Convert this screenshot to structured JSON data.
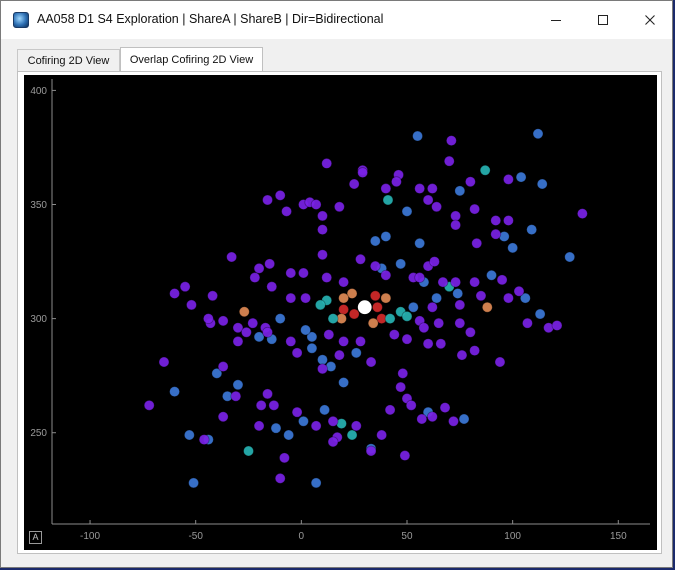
{
  "window": {
    "title": "AA058 D1 S4 Exploration | ShareA | ShareB | Dir=Bidirectional",
    "minimize_label": "—",
    "maximize_label": "☐",
    "close_label": "✕"
  },
  "tabs": [
    {
      "label": "Cofiring 2D View",
      "active": false
    },
    {
      "label": "Overlap Cofiring 2D View",
      "active": true
    }
  ],
  "plot": {
    "autoscale_label": "A",
    "background": "#000000"
  },
  "chart_data": {
    "type": "scatter",
    "title": "",
    "xlabel": "",
    "ylabel": "",
    "xlim": [
      -118,
      165
    ],
    "ylim": [
      210,
      405
    ],
    "xticks": [
      -100,
      -50,
      0,
      50,
      100,
      150
    ],
    "yticks": [
      250,
      300,
      350,
      400
    ],
    "grid": false,
    "legend": "none",
    "color_legend": {
      "purple": "#7a22e6",
      "blue": "#3c78d8",
      "teal": "#27b3b3",
      "orange": "#e08a55",
      "red": "#d42a2a",
      "highlight": "#ffffff"
    },
    "points": [
      {
        "x": 30,
        "y": 305,
        "c": "highlight"
      },
      {
        "x": 25,
        "y": 302,
        "c": "red"
      },
      {
        "x": 20,
        "y": 304,
        "c": "red"
      },
      {
        "x": 35,
        "y": 310,
        "c": "red"
      },
      {
        "x": 36,
        "y": 305,
        "c": "red"
      },
      {
        "x": 38,
        "y": 300,
        "c": "red"
      },
      {
        "x": 24,
        "y": 311,
        "c": "orange"
      },
      {
        "x": 20,
        "y": 309,
        "c": "orange"
      },
      {
        "x": 40,
        "y": 309,
        "c": "orange"
      },
      {
        "x": 34,
        "y": 298,
        "c": "orange"
      },
      {
        "x": 19,
        "y": 300,
        "c": "orange"
      },
      {
        "x": -27,
        "y": 303,
        "c": "orange"
      },
      {
        "x": 88,
        "y": 305,
        "c": "orange"
      },
      {
        "x": 47,
        "y": 303,
        "c": "teal"
      },
      {
        "x": 50,
        "y": 301,
        "c": "teal"
      },
      {
        "x": 42,
        "y": 300,
        "c": "teal"
      },
      {
        "x": 12,
        "y": 308,
        "c": "teal"
      },
      {
        "x": 9,
        "y": 306,
        "c": "teal"
      },
      {
        "x": 15,
        "y": 300,
        "c": "teal"
      },
      {
        "x": 41,
        "y": 352,
        "c": "teal"
      },
      {
        "x": 87,
        "y": 365,
        "c": "teal"
      },
      {
        "x": 70,
        "y": 314,
        "c": "teal"
      },
      {
        "x": 24,
        "y": 249,
        "c": "teal"
      },
      {
        "x": 19,
        "y": 254,
        "c": "teal"
      },
      {
        "x": -25,
        "y": 242,
        "c": "teal"
      },
      {
        "x": 5,
        "y": 287,
        "c": "blue"
      },
      {
        "x": 55,
        "y": 380,
        "c": "blue"
      },
      {
        "x": 112,
        "y": 381,
        "c": "blue"
      },
      {
        "x": 104,
        "y": 362,
        "c": "blue"
      },
      {
        "x": 114,
        "y": 359,
        "c": "blue"
      },
      {
        "x": 75,
        "y": 356,
        "c": "blue"
      },
      {
        "x": 50,
        "y": 347,
        "c": "blue"
      },
      {
        "x": 56,
        "y": 333,
        "c": "blue"
      },
      {
        "x": 35,
        "y": 334,
        "c": "blue"
      },
      {
        "x": 40,
        "y": 336,
        "c": "blue"
      },
      {
        "x": 47,
        "y": 324,
        "c": "blue"
      },
      {
        "x": 38,
        "y": 322,
        "c": "blue"
      },
      {
        "x": 58,
        "y": 316,
        "c": "blue"
      },
      {
        "x": 64,
        "y": 309,
        "c": "blue"
      },
      {
        "x": 74,
        "y": 311,
        "c": "blue"
      },
      {
        "x": 53,
        "y": 305,
        "c": "blue"
      },
      {
        "x": 5,
        "y": 292,
        "c": "blue"
      },
      {
        "x": 2,
        "y": 295,
        "c": "blue"
      },
      {
        "x": -10,
        "y": 300,
        "c": "blue"
      },
      {
        "x": -14,
        "y": 291,
        "c": "blue"
      },
      {
        "x": -20,
        "y": 292,
        "c": "blue"
      },
      {
        "x": 10,
        "y": 282,
        "c": "blue"
      },
      {
        "x": 14,
        "y": 279,
        "c": "blue"
      },
      {
        "x": 20,
        "y": 272,
        "c": "blue"
      },
      {
        "x": 26,
        "y": 285,
        "c": "blue"
      },
      {
        "x": -40,
        "y": 276,
        "c": "blue"
      },
      {
        "x": -30,
        "y": 271,
        "c": "blue"
      },
      {
        "x": -35,
        "y": 266,
        "c": "blue"
      },
      {
        "x": 11,
        "y": 260,
        "c": "blue"
      },
      {
        "x": 1,
        "y": 255,
        "c": "blue"
      },
      {
        "x": -6,
        "y": 249,
        "c": "blue"
      },
      {
        "x": -12,
        "y": 252,
        "c": "blue"
      },
      {
        "x": -44,
        "y": 247,
        "c": "blue"
      },
      {
        "x": -53,
        "y": 249,
        "c": "blue"
      },
      {
        "x": -51,
        "y": 228,
        "c": "blue"
      },
      {
        "x": 7,
        "y": 228,
        "c": "blue"
      },
      {
        "x": 33,
        "y": 243,
        "c": "blue"
      },
      {
        "x": 90,
        "y": 319,
        "c": "blue"
      },
      {
        "x": 96,
        "y": 336,
        "c": "blue"
      },
      {
        "x": 100,
        "y": 331,
        "c": "blue"
      },
      {
        "x": 109,
        "y": 339,
        "c": "blue"
      },
      {
        "x": 127,
        "y": 327,
        "c": "blue"
      },
      {
        "x": 113,
        "y": 302,
        "c": "blue"
      },
      {
        "x": 106,
        "y": 309,
        "c": "blue"
      },
      {
        "x": 60,
        "y": 259,
        "c": "blue"
      },
      {
        "x": 77,
        "y": 256,
        "c": "blue"
      },
      {
        "x": -60,
        "y": 268,
        "c": "blue"
      },
      {
        "x": 73,
        "y": 345,
        "c": "purple"
      },
      {
        "x": 64,
        "y": 349,
        "c": "purple"
      },
      {
        "x": 71,
        "y": 378,
        "c": "purple"
      },
      {
        "x": 70,
        "y": 369,
        "c": "purple"
      },
      {
        "x": 80,
        "y": 360,
        "c": "purple"
      },
      {
        "x": 12,
        "y": 368,
        "c": "purple"
      },
      {
        "x": 29,
        "y": 365,
        "c": "purple"
      },
      {
        "x": 29,
        "y": 364,
        "c": "purple"
      },
      {
        "x": 46,
        "y": 363,
        "c": "purple"
      },
      {
        "x": 45,
        "y": 360,
        "c": "purple"
      },
      {
        "x": 40,
        "y": 357,
        "c": "purple"
      },
      {
        "x": 56,
        "y": 357,
        "c": "purple"
      },
      {
        "x": 62,
        "y": 357,
        "c": "purple"
      },
      {
        "x": 98,
        "y": 361,
        "c": "purple"
      },
      {
        "x": 25,
        "y": 359,
        "c": "purple"
      },
      {
        "x": -10,
        "y": 354,
        "c": "purple"
      },
      {
        "x": -16,
        "y": 352,
        "c": "purple"
      },
      {
        "x": -7,
        "y": 347,
        "c": "purple"
      },
      {
        "x": 1,
        "y": 350,
        "c": "purple"
      },
      {
        "x": 4,
        "y": 351,
        "c": "purple"
      },
      {
        "x": 7,
        "y": 350,
        "c": "purple"
      },
      {
        "x": 18,
        "y": 349,
        "c": "purple"
      },
      {
        "x": 10,
        "y": 345,
        "c": "purple"
      },
      {
        "x": 10,
        "y": 339,
        "c": "purple"
      },
      {
        "x": 60,
        "y": 352,
        "c": "purple"
      },
      {
        "x": 82,
        "y": 348,
        "c": "purple"
      },
      {
        "x": 73,
        "y": 341,
        "c": "purple"
      },
      {
        "x": 92,
        "y": 343,
        "c": "purple"
      },
      {
        "x": 98,
        "y": 343,
        "c": "purple"
      },
      {
        "x": 92,
        "y": 337,
        "c": "purple"
      },
      {
        "x": 83,
        "y": 333,
        "c": "purple"
      },
      {
        "x": 133,
        "y": 346,
        "c": "purple"
      },
      {
        "x": -33,
        "y": 327,
        "c": "purple"
      },
      {
        "x": -15,
        "y": 324,
        "c": "purple"
      },
      {
        "x": -20,
        "y": 322,
        "c": "purple"
      },
      {
        "x": -22,
        "y": 318,
        "c": "purple"
      },
      {
        "x": -14,
        "y": 314,
        "c": "purple"
      },
      {
        "x": -5,
        "y": 320,
        "c": "purple"
      },
      {
        "x": 1,
        "y": 320,
        "c": "purple"
      },
      {
        "x": 12,
        "y": 318,
        "c": "purple"
      },
      {
        "x": 20,
        "y": 316,
        "c": "purple"
      },
      {
        "x": 28,
        "y": 326,
        "c": "purple"
      },
      {
        "x": 35,
        "y": 323,
        "c": "purple"
      },
      {
        "x": 40,
        "y": 319,
        "c": "purple"
      },
      {
        "x": 53,
        "y": 318,
        "c": "purple"
      },
      {
        "x": 56,
        "y": 318,
        "c": "purple"
      },
      {
        "x": 60,
        "y": 323,
        "c": "purple"
      },
      {
        "x": 63,
        "y": 325,
        "c": "purple"
      },
      {
        "x": 67,
        "y": 316,
        "c": "purple"
      },
      {
        "x": 73,
        "y": 316,
        "c": "purple"
      },
      {
        "x": 82,
        "y": 316,
        "c": "purple"
      },
      {
        "x": 85,
        "y": 310,
        "c": "purple"
      },
      {
        "x": 75,
        "y": 306,
        "c": "purple"
      },
      {
        "x": 62,
        "y": 305,
        "c": "purple"
      },
      {
        "x": 56,
        "y": 299,
        "c": "purple"
      },
      {
        "x": 58,
        "y": 296,
        "c": "purple"
      },
      {
        "x": 65,
        "y": 298,
        "c": "purple"
      },
      {
        "x": 75,
        "y": 298,
        "c": "purple"
      },
      {
        "x": 80,
        "y": 294,
        "c": "purple"
      },
      {
        "x": 60,
        "y": 289,
        "c": "purple"
      },
      {
        "x": 66,
        "y": 289,
        "c": "purple"
      },
      {
        "x": 76,
        "y": 284,
        "c": "purple"
      },
      {
        "x": 82,
        "y": 286,
        "c": "purple"
      },
      {
        "x": 94,
        "y": 281,
        "c": "purple"
      },
      {
        "x": 95,
        "y": 317,
        "c": "purple"
      },
      {
        "x": 103,
        "y": 312,
        "c": "purple"
      },
      {
        "x": 98,
        "y": 309,
        "c": "purple"
      },
      {
        "x": 117,
        "y": 296,
        "c": "purple"
      },
      {
        "x": 121,
        "y": 297,
        "c": "purple"
      },
      {
        "x": 107,
        "y": 298,
        "c": "purple"
      },
      {
        "x": -60,
        "y": 311,
        "c": "purple"
      },
      {
        "x": -55,
        "y": 314,
        "c": "purple"
      },
      {
        "x": -52,
        "y": 306,
        "c": "purple"
      },
      {
        "x": -42,
        "y": 310,
        "c": "purple"
      },
      {
        "x": -43,
        "y": 298,
        "c": "purple"
      },
      {
        "x": -37,
        "y": 299,
        "c": "purple"
      },
      {
        "x": -30,
        "y": 296,
        "c": "purple"
      },
      {
        "x": -23,
        "y": 298,
        "c": "purple"
      },
      {
        "x": -26,
        "y": 294,
        "c": "purple"
      },
      {
        "x": -30,
        "y": 290,
        "c": "purple"
      },
      {
        "x": -17,
        "y": 296,
        "c": "purple"
      },
      {
        "x": -16,
        "y": 294,
        "c": "purple"
      },
      {
        "x": -5,
        "y": 290,
        "c": "purple"
      },
      {
        "x": -2,
        "y": 285,
        "c": "purple"
      },
      {
        "x": 2,
        "y": 309,
        "c": "purple"
      },
      {
        "x": -5,
        "y": 309,
        "c": "purple"
      },
      {
        "x": 13,
        "y": 293,
        "c": "purple"
      },
      {
        "x": 18,
        "y": 284,
        "c": "purple"
      },
      {
        "x": 20,
        "y": 290,
        "c": "purple"
      },
      {
        "x": 33,
        "y": 281,
        "c": "purple"
      },
      {
        "x": 28,
        "y": 290,
        "c": "purple"
      },
      {
        "x": 44,
        "y": 293,
        "c": "purple"
      },
      {
        "x": 50,
        "y": 291,
        "c": "purple"
      },
      {
        "x": 48,
        "y": 276,
        "c": "purple"
      },
      {
        "x": 47,
        "y": 270,
        "c": "purple"
      },
      {
        "x": 50,
        "y": 265,
        "c": "purple"
      },
      {
        "x": 52,
        "y": 262,
        "c": "purple"
      },
      {
        "x": 57,
        "y": 256,
        "c": "purple"
      },
      {
        "x": 68,
        "y": 261,
        "c": "purple"
      },
      {
        "x": 72,
        "y": 255,
        "c": "purple"
      },
      {
        "x": 62,
        "y": 257,
        "c": "purple"
      },
      {
        "x": -37,
        "y": 279,
        "c": "purple"
      },
      {
        "x": -31,
        "y": 266,
        "c": "purple"
      },
      {
        "x": -16,
        "y": 267,
        "c": "purple"
      },
      {
        "x": -13,
        "y": 262,
        "c": "purple"
      },
      {
        "x": -19,
        "y": 262,
        "c": "purple"
      },
      {
        "x": -37,
        "y": 257,
        "c": "purple"
      },
      {
        "x": -20,
        "y": 253,
        "c": "purple"
      },
      {
        "x": -2,
        "y": 259,
        "c": "purple"
      },
      {
        "x": 7,
        "y": 253,
        "c": "purple"
      },
      {
        "x": 15,
        "y": 255,
        "c": "purple"
      },
      {
        "x": 17,
        "y": 248,
        "c": "purple"
      },
      {
        "x": 26,
        "y": 253,
        "c": "purple"
      },
      {
        "x": 38,
        "y": 249,
        "c": "purple"
      },
      {
        "x": 42,
        "y": 260,
        "c": "purple"
      },
      {
        "x": 15,
        "y": 246,
        "c": "purple"
      },
      {
        "x": 33,
        "y": 242,
        "c": "purple"
      },
      {
        "x": 49,
        "y": 240,
        "c": "purple"
      },
      {
        "x": -46,
        "y": 247,
        "c": "purple"
      },
      {
        "x": -8,
        "y": 239,
        "c": "purple"
      },
      {
        "x": -10,
        "y": 230,
        "c": "purple"
      },
      {
        "x": -65,
        "y": 281,
        "c": "purple"
      },
      {
        "x": -72,
        "y": 262,
        "c": "purple"
      },
      {
        "x": 10,
        "y": 278,
        "c": "purple"
      },
      {
        "x": 10,
        "y": 328,
        "c": "purple"
      },
      {
        "x": -44,
        "y": 300,
        "c": "purple"
      }
    ]
  }
}
